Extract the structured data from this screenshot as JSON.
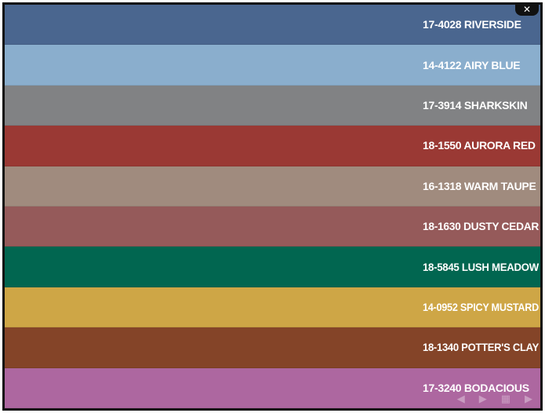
{
  "swatches": [
    {
      "label": "17-4028 RIVERSIDE",
      "color": "#4a668f"
    },
    {
      "label": "14-4122 AIRY BLUE",
      "color": "#8aaecd"
    },
    {
      "label": "17-3914 SHARKSKIN",
      "color": "#818284"
    },
    {
      "label": "18-1550 AURORA RED",
      "color": "#9a3934"
    },
    {
      "label": "16-1318 WARM TAUPE",
      "color": "#a08b7e"
    },
    {
      "label": "18-1630 DUSTY CEDAR",
      "color": "#955a5a"
    },
    {
      "label": "18-5845 LUSH MEADOW",
      "color": "#016650"
    },
    {
      "label": "14-0952 SPICY MUSTARD",
      "color": "#cea646"
    },
    {
      "label": "18-1340 POTTER'S CLAY",
      "color": "#844428"
    },
    {
      "label": "17-3240 BODACIOUS",
      "color": "#ad67a0"
    }
  ],
  "controls": {
    "close_icon": "close-icon",
    "prev_icon": "arrow-left-icon",
    "play_icon": "play-icon",
    "grid_icon": "grid-icon",
    "next_icon": "arrow-right-icon"
  }
}
